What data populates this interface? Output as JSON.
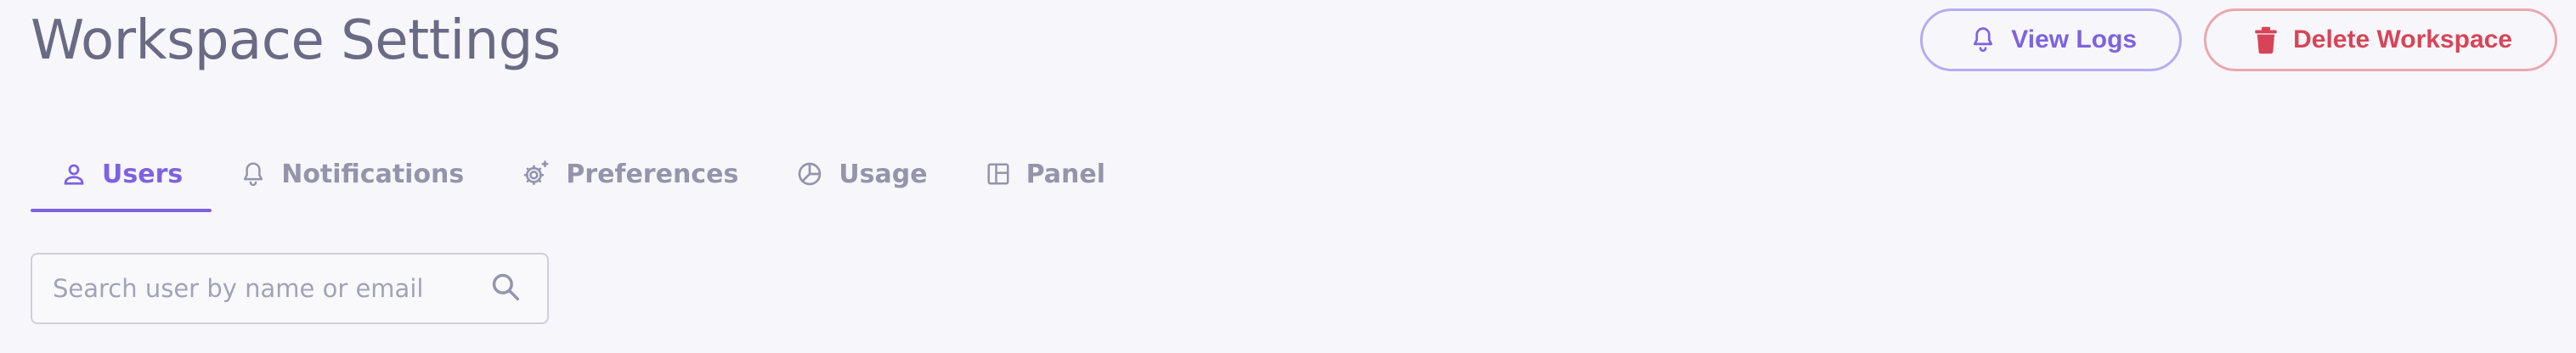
{
  "header": {
    "title": "Workspace Settings"
  },
  "actions": {
    "view_logs_label": "View Logs",
    "delete_label": "Delete Workspace"
  },
  "tabs": [
    {
      "label": "Users",
      "icon": "user-icon",
      "active": true
    },
    {
      "label": "Notifications",
      "icon": "bell-icon",
      "active": false
    },
    {
      "label": "Preferences",
      "icon": "gear-sparkle-icon",
      "active": false
    },
    {
      "label": "Usage",
      "icon": "pie-chart-icon",
      "active": false
    },
    {
      "label": "Panel",
      "icon": "layout-icon",
      "active": false
    }
  ],
  "search": {
    "placeholder": "Search user by name or email",
    "value": ""
  },
  "colors": {
    "accent": "#7e62e0",
    "danger": "#d84457",
    "title": "#6b6a85",
    "muted": "#9694ab"
  }
}
